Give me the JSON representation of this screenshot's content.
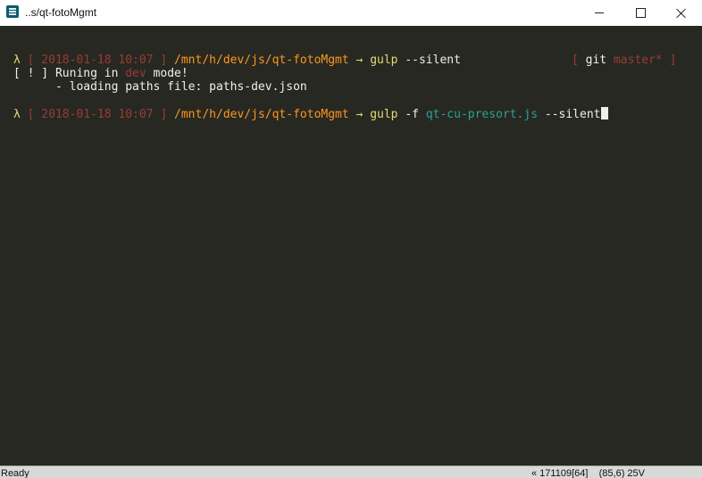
{
  "window": {
    "title": "..s/qt-fotoMgmt",
    "controls": {
      "minimize": "minimize",
      "maximize": "maximize",
      "close": "close"
    }
  },
  "console": {
    "prompt1": {
      "lambda": "λ",
      "timestamp": "[ 2018-01-18 10:07 ]",
      "path": "/mnt/h/dev/js/qt-fotoMgmt",
      "arrow": "→",
      "command": "gulp",
      "args": "--silent"
    },
    "git_prompt": {
      "open": "[",
      "label": "git",
      "branch": "master*",
      "close": "]"
    },
    "output1": {
      "prefix": "[ ! ] Runing in",
      "mode": "dev",
      "suffix": "mode!"
    },
    "output2": "      - loading paths file: paths-dev.json",
    "prompt2": {
      "lambda": "λ",
      "timestamp": "[ 2018-01-18 10:07 ]",
      "path": "/mnt/h/dev/js/qt-fotoMgmt",
      "arrow": "→",
      "command": "gulp",
      "flag": "-f",
      "file": "qt-cu-presort.js",
      "args": "--silent"
    }
  },
  "statusbar": {
    "status": "Ready",
    "info": "« 171109[64]    (85,6) 25V"
  },
  "colors": {
    "background": "#272822",
    "prompt_yellow": "#e6db74",
    "path_orange": "#fd971f",
    "bracket_red": "#9a3c34",
    "file_teal": "#2aa198"
  }
}
